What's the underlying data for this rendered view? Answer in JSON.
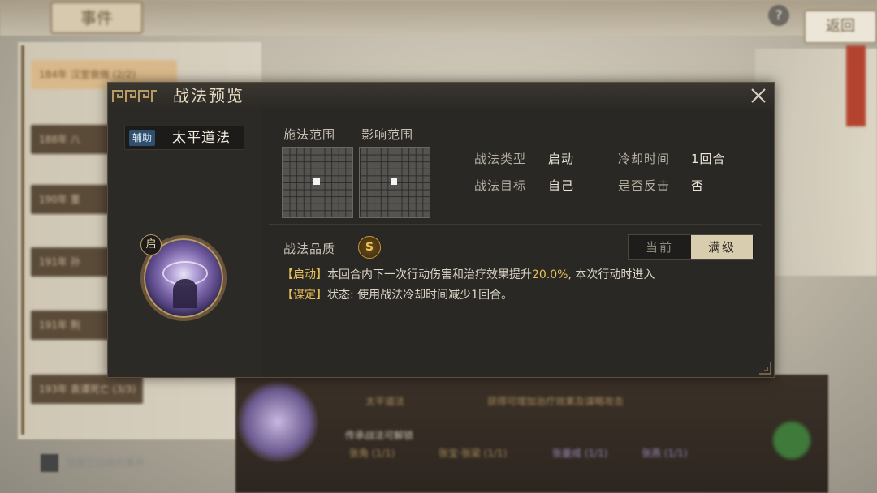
{
  "background": {
    "title_tab": "事件",
    "help_icon": "?",
    "return_button": "返回",
    "events": [
      "184年 汉室衰微 (2/2)",
      "188年 八",
      "190年 董",
      "191年 孙",
      "191年 荆",
      "193年 袁谭死亡 (3/3)"
    ],
    "bottom_check_label": "隐藏已达成的事件",
    "bottom_skill_name": "太平道法",
    "bottom_hint": "传承战法可解锁",
    "bottom_desc": "获得可增加治疗效果及谋略攻击",
    "bottom_tags": [
      "张角 (1/1)",
      "张宝·张梁 (1/1)",
      "张曼成 (1/1)",
      "张燕 (1/1)"
    ]
  },
  "modal": {
    "title": "战法预览",
    "skill": {
      "tag": "辅助",
      "name": "太平道法",
      "badge": "启"
    },
    "cast_range_label": "施法范围",
    "effect_range_label": "影响范围",
    "attrs": {
      "type_label": "战法类型",
      "type_value": "启动",
      "cooldown_label": "冷却时间",
      "cooldown_value": "1回合",
      "target_label": "战法目标",
      "target_value": "自己",
      "counter_label": "是否反击",
      "counter_value": "否"
    },
    "quality_label": "战法品质",
    "quality_value": "S",
    "level_toggle": {
      "current": "当前",
      "max": "满级",
      "selected": "满级"
    },
    "description": {
      "tag1": "【启动】",
      "line1_a": "本回合内下一次行动伤害和治疗效果提升",
      "line1_value": "20.0%",
      "line1_b": ", 本次行动时进入",
      "tag2": "【谋定】",
      "line2": "状态: 使用战法冷却时间减少1回合。"
    }
  },
  "colors": {
    "accent_gold": "#e9c15a",
    "modal_bg": "#2a2825",
    "tag_blue": "#2f4f6e"
  }
}
